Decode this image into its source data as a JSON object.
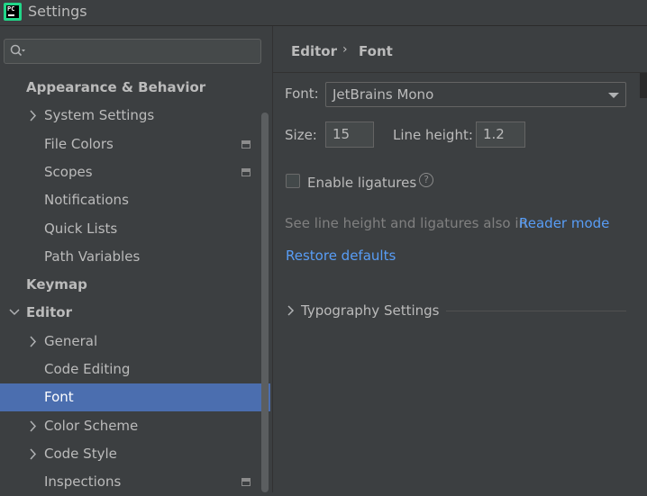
{
  "window": {
    "title": "Settings",
    "app_icon": "PC"
  },
  "sidebar": {
    "items": [
      {
        "label": "Appearance & Behavior",
        "bold": true,
        "indent": 0,
        "arrow": "none",
        "selected": false,
        "project_icon": false
      },
      {
        "label": "System Settings",
        "bold": false,
        "indent": 1,
        "arrow": "right",
        "selected": false,
        "project_icon": false
      },
      {
        "label": "File Colors",
        "bold": false,
        "indent": 1,
        "arrow": "none",
        "selected": false,
        "project_icon": true
      },
      {
        "label": "Scopes",
        "bold": false,
        "indent": 1,
        "arrow": "none",
        "selected": false,
        "project_icon": true
      },
      {
        "label": "Notifications",
        "bold": false,
        "indent": 1,
        "arrow": "none",
        "selected": false,
        "project_icon": false
      },
      {
        "label": "Quick Lists",
        "bold": false,
        "indent": 1,
        "arrow": "none",
        "selected": false,
        "project_icon": false
      },
      {
        "label": "Path Variables",
        "bold": false,
        "indent": 1,
        "arrow": "none",
        "selected": false,
        "project_icon": false
      },
      {
        "label": "Keymap",
        "bold": true,
        "indent": 0,
        "arrow": "none",
        "selected": false,
        "project_icon": false
      },
      {
        "label": "Editor",
        "bold": true,
        "indent": 0,
        "arrow": "down",
        "selected": false,
        "project_icon": false
      },
      {
        "label": "General",
        "bold": false,
        "indent": 1,
        "arrow": "right",
        "selected": false,
        "project_icon": false
      },
      {
        "label": "Code Editing",
        "bold": false,
        "indent": 1,
        "arrow": "none",
        "selected": false,
        "project_icon": false
      },
      {
        "label": "Font",
        "bold": false,
        "indent": 1,
        "arrow": "none",
        "selected": true,
        "project_icon": false
      },
      {
        "label": "Color Scheme",
        "bold": false,
        "indent": 1,
        "arrow": "right",
        "selected": false,
        "project_icon": false
      },
      {
        "label": "Code Style",
        "bold": false,
        "indent": 1,
        "arrow": "right",
        "selected": false,
        "project_icon": false
      },
      {
        "label": "Inspections",
        "bold": false,
        "indent": 1,
        "arrow": "none",
        "selected": false,
        "project_icon": true
      }
    ]
  },
  "breadcrumb": {
    "parent": "Editor",
    "separator": "›",
    "current": "Font"
  },
  "font_settings": {
    "font_label": "Font:",
    "font_value": "JetBrains Mono",
    "size_label": "Size:",
    "size_value": "15",
    "line_height_label": "Line height:",
    "line_height_value": "1.2",
    "ligatures_label": "Enable ligatures",
    "ligatures_checked": false,
    "help_glyph": "?",
    "hint_text": "See line height and ligatures also in ",
    "reader_mode_link": "Reader mode",
    "restore_link": "Restore defaults",
    "typography_label": "Typography Settings"
  },
  "colors": {
    "selection": "#4b6eaf",
    "link": "#589df6",
    "background": "#3c3f41"
  }
}
